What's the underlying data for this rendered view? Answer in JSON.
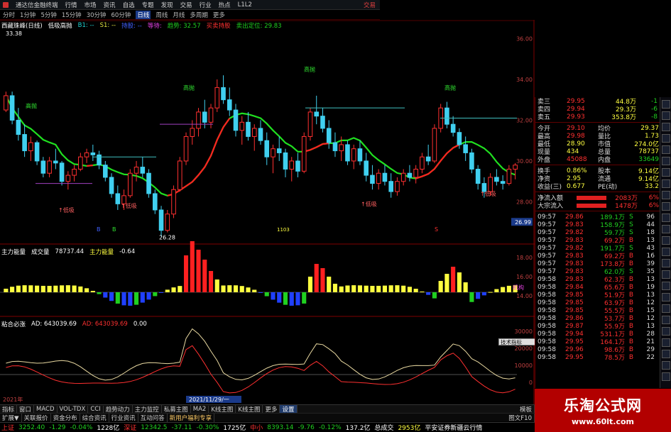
{
  "titlebar": {
    "app": "通达信金融终端",
    "menu": [
      "行情",
      "市场",
      "资讯",
      "自选",
      "专题",
      "发现",
      "交易",
      "行业",
      "热点",
      "L1L2"
    ],
    "trade": "交易"
  },
  "periods": [
    {
      "label": "分时",
      "active": false
    },
    {
      "label": "1分钟",
      "active": false
    },
    {
      "label": "5分钟",
      "active": false
    },
    {
      "label": "15分钟",
      "active": false
    },
    {
      "label": "30分钟",
      "active": false
    },
    {
      "label": "60分钟",
      "active": false
    },
    {
      "label": "日线",
      "active": true
    },
    {
      "label": "周线",
      "active": false
    },
    {
      "label": "月线",
      "active": false
    },
    {
      "label": "多周期",
      "active": false
    },
    {
      "label": "更多",
      "active": false
    }
  ],
  "main_legend": {
    "stock": "西藏珠峰(日线)",
    "indicator": "低吸高抛",
    "b1": "B1: --",
    "s1": "S1: --",
    "hold": "持股: --",
    "dummy": "等待:",
    "trend": "趋势: 32.57",
    "buy": "买卖持股",
    "sell_stop": "卖出定位: 29.83"
  },
  "main_labels": {
    "high_price": "33.38",
    "low_price": "26.28",
    "low_suck": "低吸",
    "high_throw": "高抛",
    "b_label": "B",
    "s_label": "S",
    "period_marker": "1103",
    "date_start": "2021年",
    "date_cursor": "2021/11/29/一",
    "cursor_price": "26.99"
  },
  "price_axis": [
    "36.00",
    "34.00",
    "32.00",
    "30.00",
    "28.00"
  ],
  "vol_legend": {
    "name": "主力能量",
    "vol": "成交量",
    "vol_val": "78737.44",
    "energy": "主力能量",
    "energy_val": "-0.64"
  },
  "vol_axis": [
    "18.00",
    "16.00",
    "14.00"
  ],
  "vol_tag": "机构",
  "ad_legend": {
    "name": "粘合必涨",
    "ad": "AD: 643039.69",
    "ad2": "AD: 643039.69",
    "zero": "0.00"
  },
  "ad_axis": [
    "30000",
    "20000",
    "10000",
    "0"
  ],
  "popup_label": "技术指标",
  "quote": {
    "asks": [
      {
        "label": "卖三",
        "price": "29.95",
        "vol": "44.8万",
        "flag": "-1"
      },
      {
        "label": "卖四",
        "price": "29.94",
        "vol": "29.3万",
        "flag": "-6"
      },
      {
        "label": "卖五",
        "price": "29.93",
        "vol": "353.8万",
        "flag": "-8"
      }
    ],
    "stats": [
      {
        "l1": "今开",
        "v1": "29.10",
        "l2": "均价",
        "v2": "29.37"
      },
      {
        "l1": "最高",
        "v1": "29.98",
        "l2": "量比",
        "v2": "1.73"
      },
      {
        "l1": "最低",
        "v1": "28.90",
        "l2": "市值",
        "v2": "274.0亿"
      },
      {
        "l1": "现量",
        "v1": "434",
        "l2": "总量",
        "v2": "78737"
      },
      {
        "l1": "外盘",
        "v1": "45088",
        "l2": "内盘",
        "v2": "33649"
      }
    ],
    "stats2": [
      {
        "l1": "换手",
        "v1": "0.86%",
        "l2": "股本",
        "v2": "9.14亿"
      },
      {
        "l1": "净资",
        "v1": "2.95",
        "l2": "流通",
        "v2": "9.14亿"
      },
      {
        "l1": "收益(三)",
        "v1": "0.677",
        "l2": "PE(动)",
        "v2": "33.2"
      }
    ],
    "flows": [
      {
        "label": "净流入额",
        "value": "2083万",
        "pct": "6%"
      },
      {
        "label": "大宗流入",
        "value": "1478万",
        "pct": "6%"
      }
    ],
    "ticks": [
      {
        "t": "09:57",
        "p": "29.86",
        "v": "189.1万",
        "d": "S",
        "n": "96"
      },
      {
        "t": "09:57",
        "p": "29.83",
        "v": "158.9万",
        "d": "S",
        "n": "44"
      },
      {
        "t": "09:57",
        "p": "29.82",
        "v": "59.7万",
        "d": "S",
        "n": "18"
      },
      {
        "t": "09:57",
        "p": "29.83",
        "v": "69.2万",
        "d": "B",
        "n": "13"
      },
      {
        "t": "09:57",
        "p": "29.82",
        "v": "191.7万",
        "d": "S",
        "n": "43"
      },
      {
        "t": "09:57",
        "p": "29.83",
        "v": "69.2万",
        "d": "B",
        "n": "16"
      },
      {
        "t": "09:57",
        "p": "29.83",
        "v": "173.8万",
        "d": "B",
        "n": "39"
      },
      {
        "t": "09:57",
        "p": "29.83",
        "v": "62.0万",
        "d": "S",
        "n": "35"
      },
      {
        "t": "09:58",
        "p": "29.83",
        "v": "62.3万",
        "d": "B",
        "n": "13"
      },
      {
        "t": "09:58",
        "p": "29.84",
        "v": "65.6万",
        "d": "B",
        "n": "19"
      },
      {
        "t": "09:58",
        "p": "29.85",
        "v": "51.9万",
        "d": "B",
        "n": "13"
      },
      {
        "t": "09:58",
        "p": "29.85",
        "v": "63.9万",
        "d": "B",
        "n": "12"
      },
      {
        "t": "09:58",
        "p": "29.85",
        "v": "55.5万",
        "d": "B",
        "n": "15"
      },
      {
        "t": "09:58",
        "p": "29.86",
        "v": "53.7万",
        "d": "B",
        "n": "12"
      },
      {
        "t": "09:58",
        "p": "29.87",
        "v": "55.9万",
        "d": "B",
        "n": "13"
      },
      {
        "t": "09:58",
        "p": "29.94",
        "v": "531.1万",
        "d": "B",
        "n": "28"
      },
      {
        "t": "09:58",
        "p": "29.95",
        "v": "164.1万",
        "d": "B",
        "n": "21"
      },
      {
        "t": "09:58",
        "p": "29.96",
        "v": "98.6万",
        "d": "B",
        "n": "29"
      },
      {
        "t": "09:58",
        "p": "29.95",
        "v": "78.5万",
        "d": "B",
        "n": "22"
      }
    ]
  },
  "tabs1": [
    "指标",
    "窗口",
    "MACD",
    "VOL-TDX",
    "CCI",
    "趋势动力",
    "主力监控",
    "私募主图",
    "MA2",
    "K线主图",
    "K线主图",
    "更多",
    "设置"
  ],
  "tabs1_right": "模板",
  "tabs2": [
    "扩展▼",
    "关联报价",
    "资金分布",
    "综合资讯",
    "行业资讯",
    "互动问答",
    "新用户福利专享"
  ],
  "tabs2_right": "图文F10",
  "status": {
    "sh_label": "上证",
    "sh_val": "3252.40",
    "sh_chg": "-1.29",
    "sh_pct": "-0.04%",
    "sh_amt": "1228亿",
    "sz_label": "深证",
    "sz_val": "12342.5",
    "sz_chg": "-37.11",
    "sz_pct": "-0.30%",
    "sz_amt": "1725亿",
    "zx_label": "中小",
    "zx_val": "8393.14",
    "zx_chg": "-9.76",
    "zx_pct": "-0.12%",
    "zx_amt": "137.2亿",
    "total_label": "总成交",
    "total_val": "2953亿",
    "broker": "平安证券新疆云行情"
  },
  "watermark": {
    "title": "乐淘公式网",
    "url": "www.60lt.com"
  },
  "colors": {
    "up": "#ff3030",
    "down": "#20c0e0",
    "ma": "#20d020",
    "energy_up": "#ff2020",
    "energy_mid": "#ffff40",
    "energy_low": "#2040ff",
    "energy_green": "#20d020"
  },
  "chart_data": {
    "type": "candlestick",
    "candles": [
      [
        32.5,
        33.4,
        32.4,
        33.2
      ],
      [
        33.2,
        33.4,
        31.8,
        32.0
      ],
      [
        32.0,
        32.6,
        31.0,
        31.3
      ],
      [
        31.3,
        31.8,
        30.2,
        30.5
      ],
      [
        30.5,
        31.2,
        30.0,
        30.9
      ],
      [
        30.9,
        31.0,
        29.8,
        30.0
      ],
      [
        30.0,
        30.2,
        29.2,
        29.4
      ],
      [
        29.4,
        30.2,
        29.2,
        30.0
      ],
      [
        30.0,
        30.6,
        29.6,
        29.9
      ],
      [
        29.9,
        30.0,
        28.8,
        29.0
      ],
      [
        29.0,
        29.5,
        28.6,
        29.3
      ],
      [
        29.3,
        29.8,
        29.0,
        29.6
      ],
      [
        29.6,
        30.4,
        29.5,
        30.2
      ],
      [
        30.2,
        30.6,
        29.9,
        30.4
      ],
      [
        30.4,
        30.8,
        30.0,
        30.3
      ],
      [
        30.3,
        30.5,
        29.6,
        29.8
      ],
      [
        29.8,
        30.0,
        29.0,
        29.2
      ],
      [
        29.2,
        29.4,
        28.2,
        28.4
      ],
      [
        28.4,
        28.8,
        27.6,
        27.9
      ],
      [
        27.9,
        28.6,
        27.6,
        28.3
      ],
      [
        28.3,
        29.6,
        28.2,
        29.4
      ],
      [
        29.4,
        30.0,
        29.0,
        29.7
      ],
      [
        29.7,
        30.2,
        29.2,
        29.4
      ],
      [
        29.4,
        29.6,
        28.2,
        28.4
      ],
      [
        28.4,
        28.6,
        27.4,
        27.6
      ],
      [
        27.6,
        27.8,
        26.3,
        26.6
      ],
      [
        26.6,
        27.6,
        26.5,
        27.4
      ],
      [
        27.4,
        28.8,
        27.2,
        28.6
      ],
      [
        28.6,
        30.2,
        28.5,
        30.0
      ],
      [
        30.0,
        31.4,
        29.8,
        31.2
      ],
      [
        31.2,
        32.0,
        30.8,
        31.6
      ],
      [
        31.6,
        32.6,
        31.2,
        32.4
      ],
      [
        32.4,
        33.0,
        31.6,
        31.9
      ],
      [
        31.9,
        32.8,
        31.6,
        32.6
      ],
      [
        32.6,
        34.0,
        32.4,
        33.6
      ],
      [
        33.6,
        34.2,
        32.8,
        33.0
      ],
      [
        33.0,
        33.6,
        32.2,
        32.5
      ],
      [
        32.5,
        32.8,
        31.2,
        31.5
      ],
      [
        31.5,
        32.2,
        30.8,
        31.9
      ],
      [
        31.9,
        32.4,
        31.0,
        31.2
      ],
      [
        31.2,
        31.8,
        30.5,
        31.6
      ],
      [
        31.6,
        32.0,
        30.8,
        31.0
      ],
      [
        31.0,
        31.4,
        29.8,
        30.2
      ],
      [
        30.2,
        30.8,
        29.4,
        30.6
      ],
      [
        30.6,
        31.2,
        30.0,
        30.4
      ],
      [
        30.4,
        30.6,
        29.2,
        29.6
      ],
      [
        29.6,
        30.2,
        29.0,
        30.0
      ],
      [
        30.0,
        30.4,
        29.2,
        29.5
      ],
      [
        29.5,
        31.4,
        29.4,
        31.2
      ],
      [
        31.2,
        32.6,
        31.0,
        32.4
      ],
      [
        32.4,
        33.2,
        31.8,
        32.2
      ],
      [
        32.2,
        32.6,
        31.4,
        31.6
      ],
      [
        31.6,
        32.0,
        30.6,
        30.9
      ],
      [
        30.9,
        31.4,
        30.2,
        30.5
      ],
      [
        30.5,
        31.2,
        30.0,
        30.8
      ],
      [
        30.8,
        31.0,
        29.8,
        30.0
      ],
      [
        30.0,
        30.8,
        29.6,
        30.6
      ],
      [
        30.6,
        31.0,
        29.8,
        30.0
      ],
      [
        30.0,
        30.4,
        29.0,
        29.3
      ],
      [
        29.3,
        29.8,
        28.6,
        28.9
      ],
      [
        28.9,
        29.6,
        28.6,
        29.4
      ],
      [
        29.4,
        29.8,
        28.8,
        29.0
      ],
      [
        29.0,
        29.4,
        28.2,
        28.5
      ],
      [
        28.5,
        29.2,
        28.3,
        29.0
      ],
      [
        29.0,
        29.6,
        28.8,
        29.4
      ],
      [
        29.4,
        29.8,
        29.0,
        29.2
      ],
      [
        29.2,
        29.8,
        28.9,
        29.6
      ],
      [
        29.6,
        30.4,
        29.4,
        30.2
      ],
      [
        30.2,
        30.8,
        29.8,
        30.0
      ],
      [
        30.0,
        31.8,
        29.9,
        31.6
      ],
      [
        31.6,
        32.8,
        31.4,
        32.6
      ],
      [
        32.6,
        32.9,
        31.6,
        31.8
      ],
      [
        31.8,
        32.2,
        31.2,
        31.4
      ],
      [
        31.4,
        31.6,
        30.6,
        30.8
      ],
      [
        30.8,
        31.2,
        30.0,
        30.4
      ],
      [
        30.4,
        30.6,
        29.4,
        29.6
      ],
      [
        29.6,
        29.8,
        28.6,
        28.9
      ],
      [
        28.9,
        29.2,
        28.2,
        28.5
      ],
      [
        28.5,
        29.4,
        28.3,
        29.2
      ],
      [
        29.2,
        29.6,
        28.8,
        29.0
      ],
      [
        29.0,
        29.3,
        28.6,
        28.9
      ],
      [
        28.9,
        29.8,
        28.8,
        29.6
      ],
      [
        29.6,
        29.9,
        29.1,
        29.8
      ]
    ],
    "ylim": [
      26.0,
      36.5
    ]
  }
}
